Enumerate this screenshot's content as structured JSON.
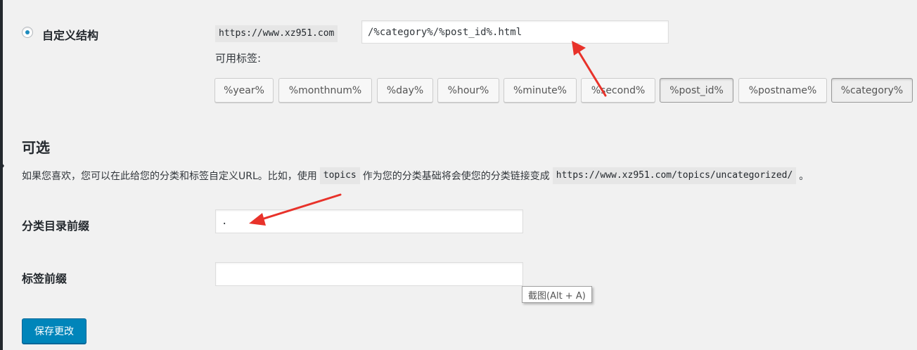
{
  "permalink": {
    "option_label": "自定义结构",
    "base_url": "https://www.xz951.com",
    "structure_value": "/%category%/%post_id%.html",
    "available_tags_label": "可用标签:",
    "tags": [
      {
        "label": "%year%",
        "active": false
      },
      {
        "label": "%monthnum%",
        "active": false
      },
      {
        "label": "%day%",
        "active": false
      },
      {
        "label": "%hour%",
        "active": false
      },
      {
        "label": "%minute%",
        "active": false
      },
      {
        "label": "%second%",
        "active": false
      },
      {
        "label": "%post_id%",
        "active": true
      },
      {
        "label": "%postname%",
        "active": false
      },
      {
        "label": "%category%",
        "active": true
      }
    ]
  },
  "optional": {
    "heading": "可选",
    "desc_part1": "如果您喜欢，您可以在此给您的分类和标签自定义URL。比如，使用",
    "desc_code1": "topics",
    "desc_part2": "作为您的分类基础将会使您的分类链接变成",
    "desc_code2": "https://www.xz951.com/topics/uncategorized/",
    "desc_part3": "。"
  },
  "category_base": {
    "label": "分类目录前缀",
    "value": "."
  },
  "tag_base": {
    "label": "标签前缀",
    "value": ""
  },
  "tooltip": "截图(Alt + A)",
  "save_button": "保存更改",
  "colors": {
    "accent": "#0085ba",
    "arrow": "#e8322a"
  }
}
